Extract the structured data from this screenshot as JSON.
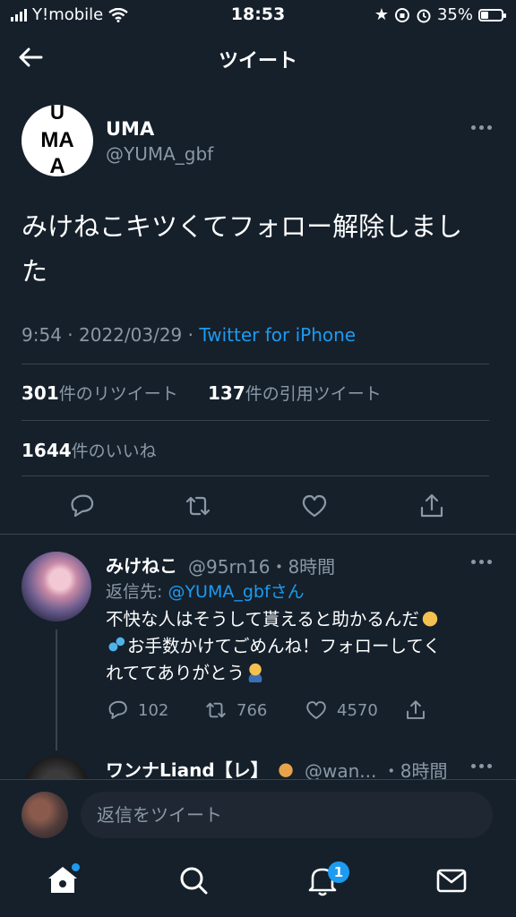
{
  "status_bar": {
    "carrier": "Y!mobile",
    "time": "18:53",
    "battery": "35%",
    "battery_level": 0.35
  },
  "header": {
    "title": "ツイート"
  },
  "tweet": {
    "author_name": "UMA",
    "author_handle": "@YUMA_gbf",
    "text": "みけねこキツくてフォロー解除しました",
    "time": "9:54",
    "date": "2022/03/29",
    "source": "Twitter for iPhone",
    "retweets_count": "301",
    "retweets_label": "件のリツイート",
    "quotes_count": "137",
    "quotes_label": "件の引用ツイート",
    "likes_count": "1644",
    "likes_label": "件のいいね"
  },
  "reply": {
    "name": "みけねこ",
    "handle_time": "@95rn16・8時間",
    "reply_to_prefix": "返信先: ",
    "reply_to_handle": "@YUMA_gbfさん",
    "line1": "不快な人はそうして貰えると助かるんだ",
    "line2": "お手数かけてごめんね！フォローしてく",
    "line3": "れててありがとう",
    "replies": "102",
    "retweets": "766",
    "likes": "4570"
  },
  "next_reply": {
    "name": "ワンナLiand【レ】",
    "handle_time": "@wan... ・8時間"
  },
  "composer": {
    "placeholder": "返信をツイート"
  },
  "tabbar": {
    "notifications_badge": "1"
  },
  "colors": {
    "background": "#15202b",
    "accent": "#1d9bf0",
    "muted": "#8b98a5",
    "divider": "#38444d"
  }
}
